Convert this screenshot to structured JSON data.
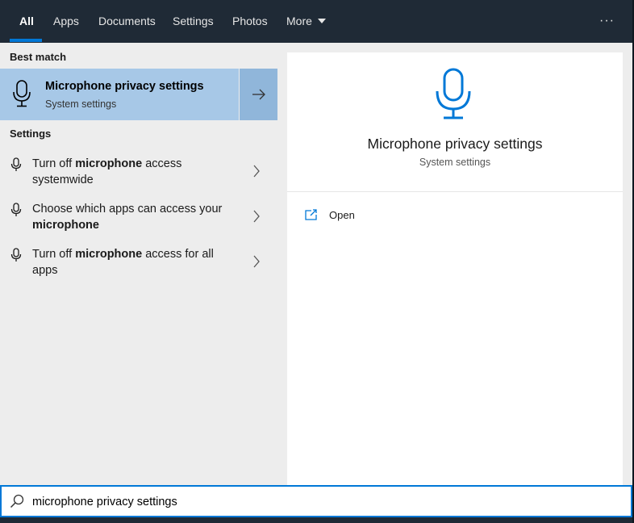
{
  "tabs": [
    {
      "label": "All",
      "active": true
    },
    {
      "label": "Apps"
    },
    {
      "label": "Documents"
    },
    {
      "label": "Settings"
    },
    {
      "label": "Photos"
    },
    {
      "label": "More"
    }
  ],
  "more_menu_icon": "ellipsis-icon",
  "left": {
    "best_match_heading": "Best match",
    "best_match": {
      "title": "Microphone privacy settings",
      "subtitle": "System settings",
      "icon": "microphone-icon"
    },
    "settings_heading": "Settings",
    "settings_items": [
      {
        "parts": [
          "Turn off ",
          "microphone",
          " access systemwide"
        ]
      },
      {
        "parts": [
          "Choose which apps can access your ",
          "microphone",
          ""
        ]
      },
      {
        "parts": [
          "Turn off ",
          "microphone",
          " access for all apps"
        ]
      }
    ]
  },
  "preview": {
    "title": "Microphone privacy settings",
    "subtitle": "System settings",
    "icon": "microphone-icon",
    "actions": [
      {
        "label": "Open",
        "icon": "open-icon"
      }
    ]
  },
  "search": {
    "value": "microphone privacy settings",
    "icon": "search-icon"
  },
  "colors": {
    "accent": "#0078d7",
    "selected_bg": "#a7c8e7",
    "taskbar": "#1f2a36"
  }
}
